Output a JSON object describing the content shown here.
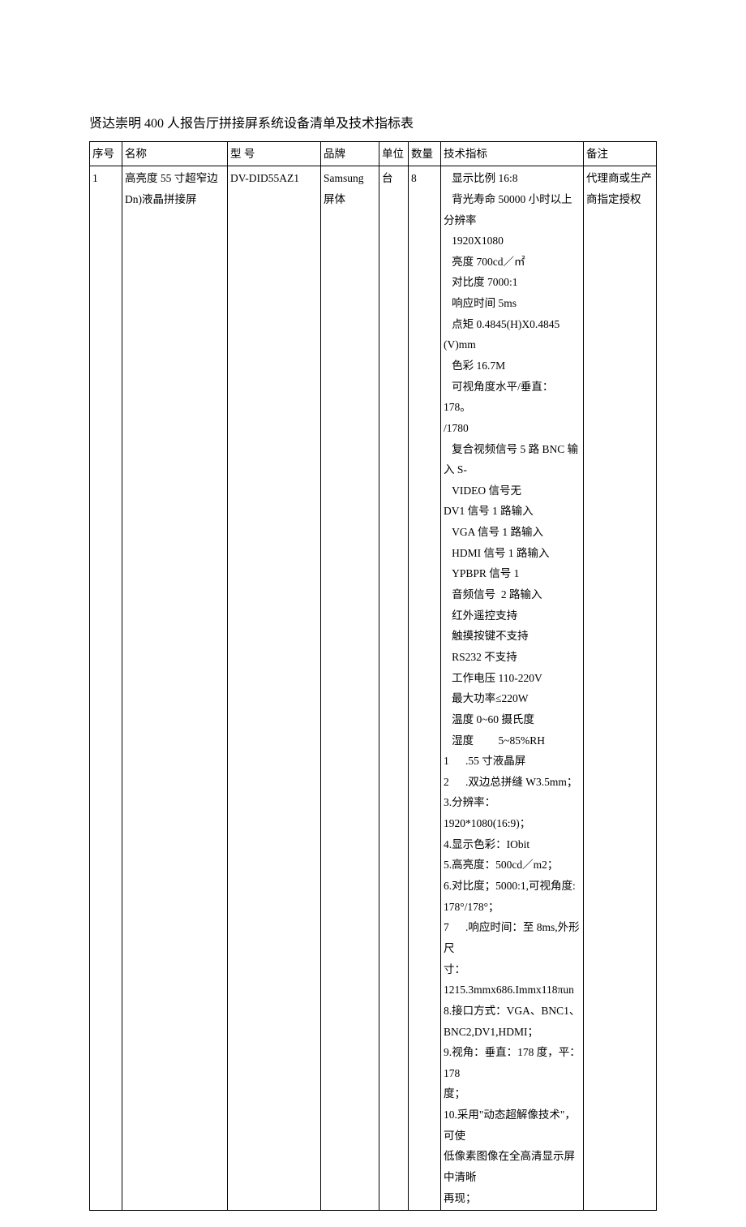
{
  "title": "贤达崇明 400 人报告厅拼接屏系统设备清单及技术指标表",
  "headers": {
    "seq": "序号",
    "name": "名称",
    "model": "型    号",
    "brand": "品牌",
    "unit": "单位",
    "qty": "数量",
    "spec": "技术指标",
    "note": "备注"
  },
  "row": {
    "seq": "1",
    "name": "高亮度 55 寸超窄边 Dn)液晶拼接屏",
    "model": "DV-DID55AZ1",
    "brand": "Samsung 屏体",
    "unit": "台",
    "qty": "8",
    "spec": "   显示比例 16:8\n   背光寿命 50000 小时以上分辨率\n   1920X1080\n   亮度 700cd／㎡\n   对比度 7000:1\n   响应时间 5ms\n   点矩 0.4845(H)X0.4845\n(V)mm\n   色彩 16.7M\n   可视角度水平/垂直：178。\n/1780\n   复合视频信号 5 路 BNC 输入 S-\n   VIDEO 信号无\nDV1 信号 1 路输入\n   VGA 信号 1 路输入\n   HDMI 信号 1 路输入\n   YPBPR 信号 1\n   音频信号  2 路输入\n   红外遥控支持\n   触摸按键不支持\n   RS232 不支持\n   工作电压 110-220V\n   最大功率≤220W\n   温度 0~60 摄氏度\n   湿度         5~85%RH\n1      .55 寸液晶屏\n2      .双边总拼缝 W3.5mm；\n3.分辨率：1920*1080(16:9)；\n4.显示色彩：IObit\n5.高亮度：500cd／m2；\n6.对比度；5000:1,可视角度:\n178°/178°；\n7      .响应时间：至 8ms,外形尺\n寸：1215.3mmx686.Immx118πun\n8.接口方式：VGA、BNC1、\nBNC2,DV1,HDMI；\n9.视角：垂直：178 度，平：178\n度；\n10.采用\"动态超解像技术\"，可使\n低像素图像在全高清显示屏中清晰\n再现；",
    "note": "代理商或生产商指定授权"
  }
}
